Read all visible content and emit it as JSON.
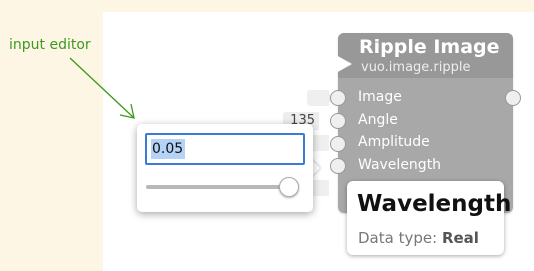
{
  "annotation": {
    "label": "input editor"
  },
  "node": {
    "title": "Ripple Image",
    "subtitle": "vuo.image.ripple",
    "ports": [
      {
        "label": "Image"
      },
      {
        "label": "Angle",
        "value": "135"
      },
      {
        "label": "Amplitude"
      },
      {
        "label": "Wavelength"
      }
    ]
  },
  "editor": {
    "value": "0.05",
    "slider_fraction": 0.95
  },
  "tooltip": {
    "title": "Wavelength",
    "type_label": "Data type:",
    "type_value": "Real"
  },
  "colors": {
    "node_body": "#a8a8a8",
    "node_header": "#989898",
    "annotation": "#3d9a1f",
    "focus": "#3b7bd6"
  }
}
